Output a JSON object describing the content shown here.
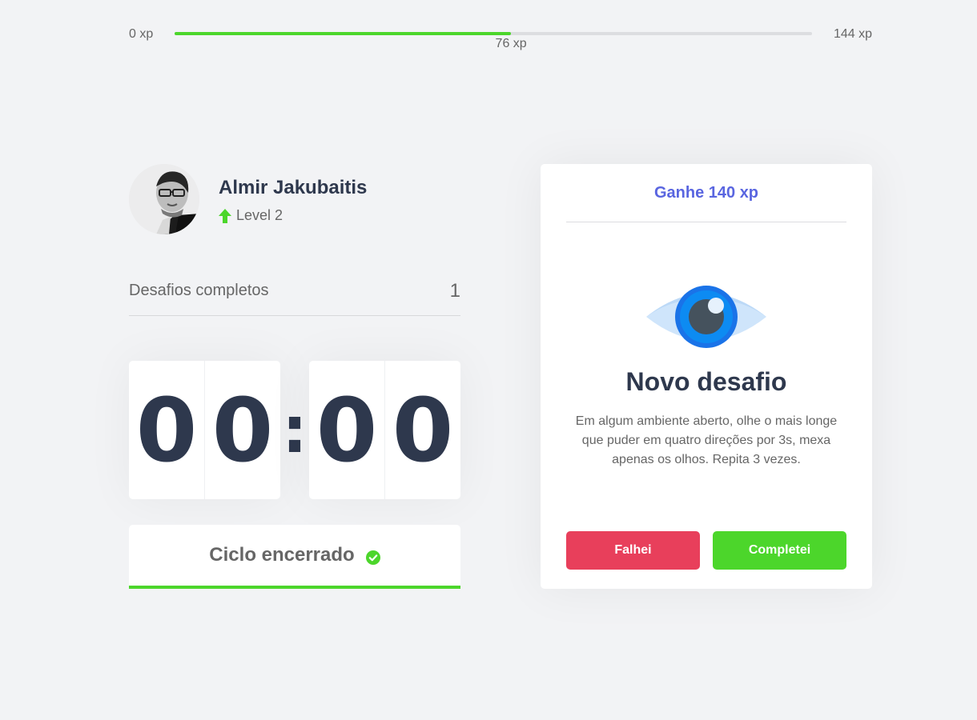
{
  "xp": {
    "min_label": "0 xp",
    "max_label": "144 xp",
    "current_label": "76 xp",
    "current": 76,
    "max": 144,
    "fill_color": "#4cd62b"
  },
  "profile": {
    "name": "Almir Jakubaitis",
    "level_label": "Level 2",
    "level_icon": "arrow-up-icon",
    "avatar": "user-avatar"
  },
  "completed": {
    "label": "Desafios completos",
    "count": "1"
  },
  "countdown": {
    "minute_left": "0",
    "minute_right": "0",
    "separator": ":",
    "second_left": "0",
    "second_right": "0"
  },
  "cycle": {
    "label": "Ciclo encerrado",
    "icon": "check-circle-icon",
    "accent": "#4cd62b"
  },
  "challenge": {
    "header": "Ganhe 140 xp",
    "icon": "eye-icon",
    "title": "Novo desafio",
    "description": "Em algum ambiente aberto, olhe o mais longe que puder em quatro direções por 3s, mexa apenas os olhos. Repita 3 vezes.",
    "fail_label": "Falhei",
    "success_label": "Completei",
    "fail_color": "#e83f5b",
    "success_color": "#4cd62b",
    "header_color": "#5965e0"
  }
}
